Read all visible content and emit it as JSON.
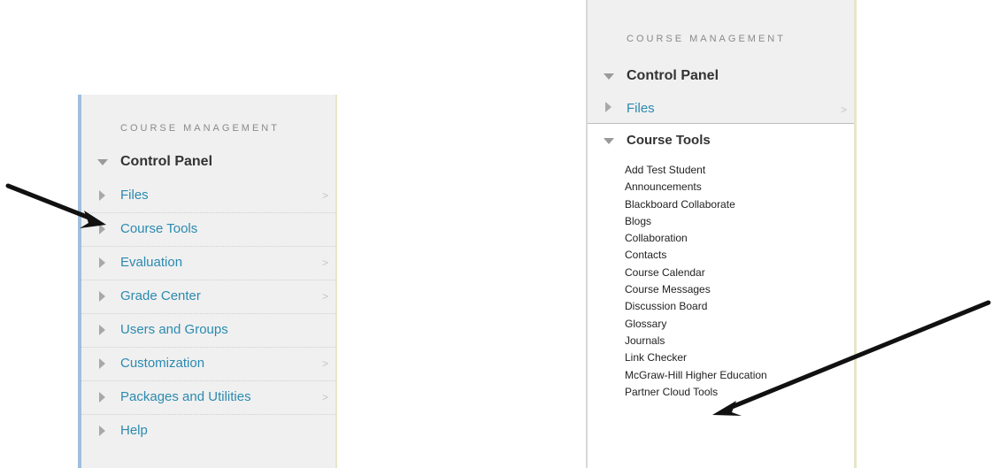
{
  "left_panel": {
    "heading": "COURSE MANAGEMENT",
    "control_panel": "Control Panel",
    "items": [
      {
        "label": "Files",
        "chevron": ">"
      },
      {
        "label": "Course Tools",
        "chevron": ""
      },
      {
        "label": "Evaluation",
        "chevron": ">"
      },
      {
        "label": "Grade Center",
        "chevron": ">"
      },
      {
        "label": "Users and Groups",
        "chevron": ""
      },
      {
        "label": "Customization",
        "chevron": ">"
      },
      {
        "label": "Packages and Utilities",
        "chevron": ">"
      },
      {
        "label": "Help",
        "chevron": ""
      }
    ]
  },
  "right_panel": {
    "heading": "COURSE MANAGEMENT",
    "control_panel": "Control Panel",
    "files": {
      "label": "Files",
      "chevron": ">"
    },
    "course_tools": {
      "label": "Course Tools",
      "items": [
        "Add Test Student",
        "Announcements",
        "Blackboard Collaborate",
        "Blogs",
        "Collaboration",
        "Contacts",
        "Course Calendar",
        "Course Messages",
        "Discussion Board",
        "Glossary",
        "Journals",
        "Link Checker",
        "McGraw-Hill Higher Education",
        "Partner Cloud Tools"
      ]
    }
  },
  "colors": {
    "link": "#2b8ab0",
    "panel_bg": "#f0f0f0",
    "arrow": "#111111"
  },
  "annotations": [
    {
      "points_to": "Course Tools",
      "icon": "arrow-annotation-icon"
    },
    {
      "points_to": "Link Checker",
      "icon": "arrow-annotation-icon"
    }
  ]
}
